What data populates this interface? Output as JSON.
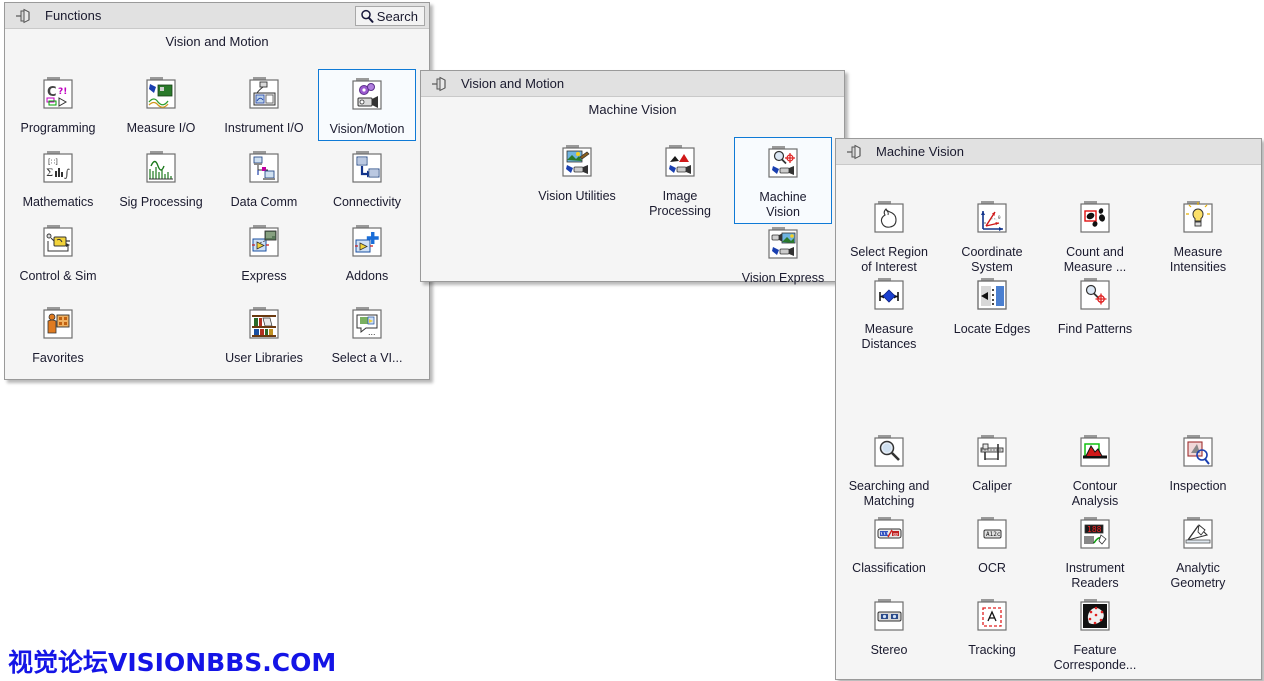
{
  "watermark": "视觉论坛VISIONBBS.COM",
  "palettes": [
    {
      "id": "functions",
      "title": "Functions",
      "pin_icon": "pushpin-icon",
      "search": {
        "label": "Search",
        "icon": "search-icon"
      },
      "category_header": "Vision and Motion",
      "items": [
        {
          "label": "Programming",
          "icon": "programming-folder-icon",
          "selected": false
        },
        {
          "label": "Measure I/O",
          "icon": "measure-io-folder-icon",
          "selected": false
        },
        {
          "label": "Instrument I/O",
          "icon": "instrument-io-folder-icon",
          "selected": false
        },
        {
          "label": "Vision/Motion",
          "icon": "vision-motion-folder-icon",
          "selected": true
        },
        {
          "label": "Mathematics",
          "icon": "mathematics-folder-icon",
          "selected": false
        },
        {
          "label": "Sig Processing",
          "icon": "sig-processing-folder-icon",
          "selected": false
        },
        {
          "label": "Data Comm",
          "icon": "data-comm-folder-icon",
          "selected": false
        },
        {
          "label": "Connectivity",
          "icon": "connectivity-folder-icon",
          "selected": false
        },
        {
          "label": "Control & Sim",
          "icon": "control-sim-folder-icon",
          "selected": false
        },
        {
          "label": "Express",
          "icon": "express-folder-icon",
          "selected": false
        },
        {
          "label": "Addons",
          "icon": "addons-folder-icon",
          "selected": false
        },
        {
          "label": "Favorites",
          "icon": "favorites-folder-icon",
          "selected": false
        },
        {
          "label": "User Libraries",
          "icon": "user-libraries-folder-icon",
          "selected": false
        },
        {
          "label": "Select a VI...",
          "icon": "select-a-vi-folder-icon",
          "selected": false
        }
      ]
    },
    {
      "id": "vision-and-motion",
      "title": "Vision and Motion",
      "pin_icon": "pushpin-icon",
      "category_header": "Machine Vision",
      "items": [
        {
          "label": "Vision Utilities",
          "icon": "vision-utilities-folder-icon",
          "selected": false
        },
        {
          "label": "Image\nProcessing",
          "icon": "image-processing-folder-icon",
          "selected": false
        },
        {
          "label": "Machine\nVision",
          "icon": "machine-vision-folder-icon",
          "selected": true
        },
        {
          "label": "Vision Express",
          "icon": "vision-express-folder-icon",
          "selected": false
        }
      ]
    },
    {
      "id": "machine-vision",
      "title": "Machine Vision",
      "pin_icon": "pushpin-icon",
      "items": [
        {
          "label": "Select Region\nof Interest",
          "icon": "select-region-of-interest-folder-icon"
        },
        {
          "label": "Coordinate\nSystem",
          "icon": "coordinate-system-folder-icon"
        },
        {
          "label": "Count and\nMeasure ...",
          "icon": "count-and-measure-folder-icon"
        },
        {
          "label": "Measure\nIntensities",
          "icon": "measure-intensities-folder-icon"
        },
        {
          "label": "Measure\nDistances",
          "icon": "measure-distances-folder-icon"
        },
        {
          "label": "Locate Edges",
          "icon": "locate-edges-folder-icon"
        },
        {
          "label": "Find Patterns",
          "icon": "find-patterns-folder-icon"
        },
        {
          "label": "Searching and\nMatching",
          "icon": "searching-and-matching-folder-icon"
        },
        {
          "label": "Caliper",
          "icon": "caliper-folder-icon"
        },
        {
          "label": "Contour\nAnalysis",
          "icon": "contour-analysis-folder-icon"
        },
        {
          "label": "Inspection",
          "icon": "inspection-folder-icon"
        },
        {
          "label": "Classification",
          "icon": "classification-folder-icon"
        },
        {
          "label": "OCR",
          "icon": "ocr-folder-icon"
        },
        {
          "label": "Instrument\nReaders",
          "icon": "instrument-readers-folder-icon"
        },
        {
          "label": "Analytic\nGeometry",
          "icon": "analytic-geometry-folder-icon"
        },
        {
          "label": "Stereo",
          "icon": "stereo-folder-icon"
        },
        {
          "label": "Tracking",
          "icon": "tracking-folder-icon"
        },
        {
          "label": "Feature\nCorresponde...",
          "icon": "feature-correspondence-folder-icon"
        }
      ]
    }
  ],
  "colors": {
    "panel_bg": "#f5f5f5",
    "titlebar_bg": "#e1e1e1",
    "selection_blue": "#0f7ad6",
    "text": "#1a1a2e",
    "watermark_blue": "#1414e6"
  }
}
